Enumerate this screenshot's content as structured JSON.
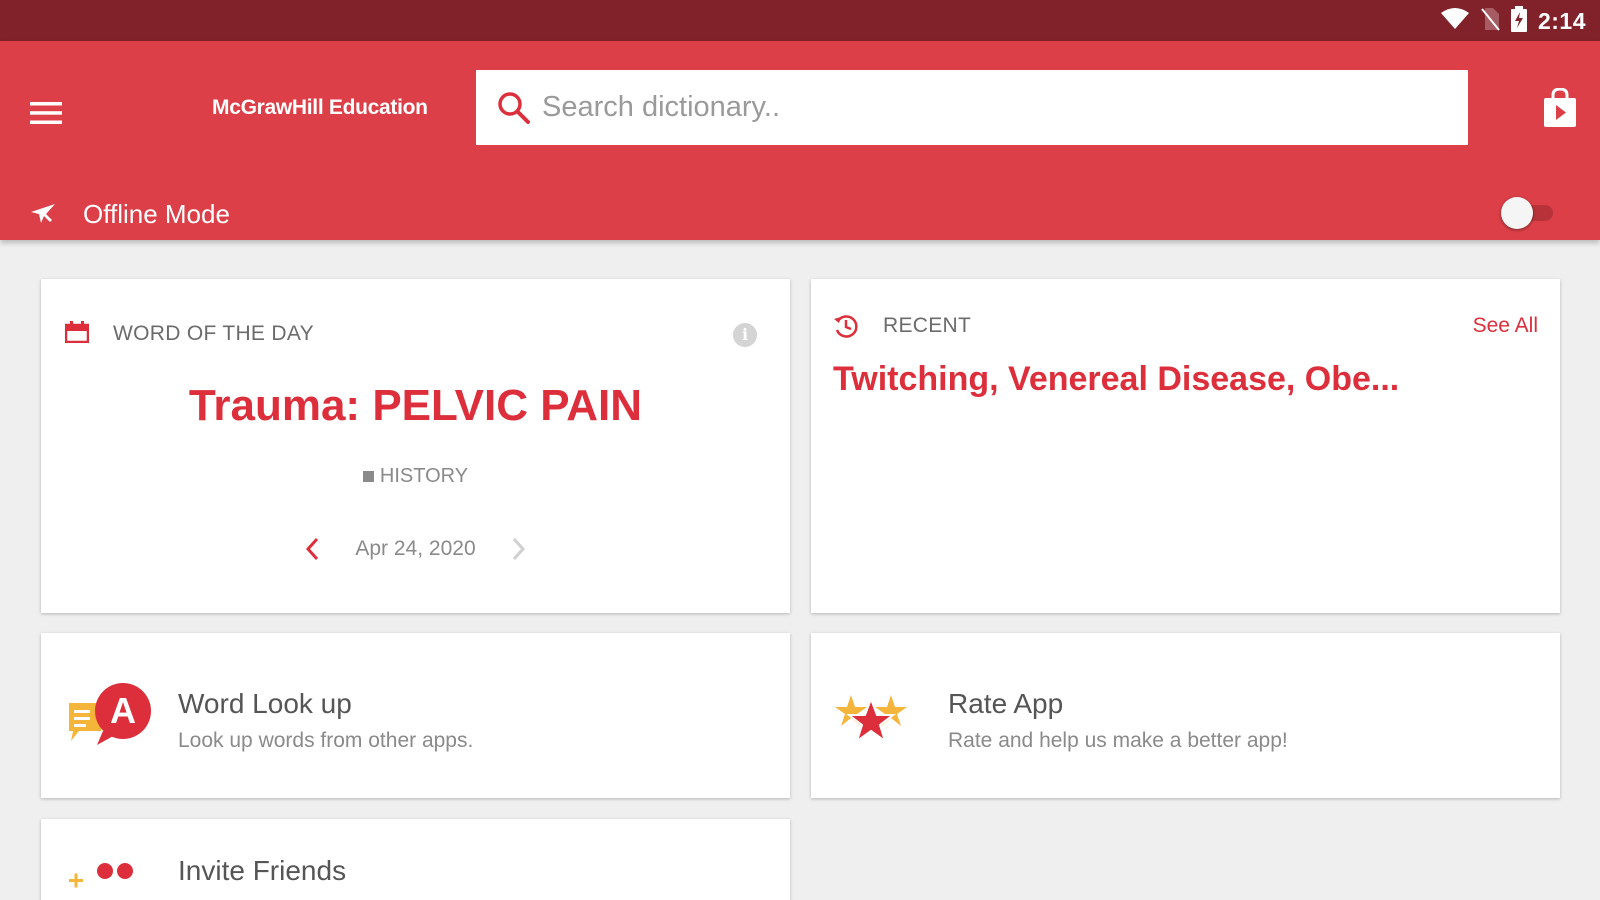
{
  "status_bar": {
    "time": "2:14",
    "icons": [
      "wifi-icon",
      "no-sim-icon",
      "battery-charging-icon"
    ]
  },
  "header": {
    "menu_icon": "menu-icon",
    "brand": "McGrawHill Education",
    "search": {
      "placeholder": "Search dictionary..",
      "value": "",
      "icon": "search-icon"
    },
    "store_icon": "shopping-bag-icon"
  },
  "offline": {
    "icon": "airplane-icon",
    "label": "Offline Mode",
    "enabled": false
  },
  "word_of_the_day": {
    "icon": "calendar-icon",
    "heading": "WORD OF THE DAY",
    "info_icon": "info-icon",
    "info_glyph": "i",
    "word": "Trauma: PELVIC PAIN",
    "tag": "HISTORY",
    "date": "Apr 24, 2020",
    "prev_icon": "chevron-left-icon",
    "next_icon": "chevron-right-icon"
  },
  "recent": {
    "icon": "history-icon",
    "heading": "RECENT",
    "see_all": "See All",
    "words": "Twitching, Venereal Disease, Obe..."
  },
  "tiles": {
    "lookup": {
      "icon": "speech-bubble-letter-icon",
      "title": "Word Look up",
      "subtitle": "Look up words from other apps."
    },
    "rate": {
      "icon": "stars-icon",
      "title": "Rate App",
      "subtitle": "Rate and help us make a better app!"
    },
    "invite": {
      "icon": "add-friends-icon",
      "title": "Invite Friends"
    }
  },
  "colors": {
    "status_bar": "#81212a",
    "app_bar": "#dc3f47",
    "accent_red": "#dc2f3b",
    "background": "#efefef",
    "yellow": "#f5b53a"
  }
}
